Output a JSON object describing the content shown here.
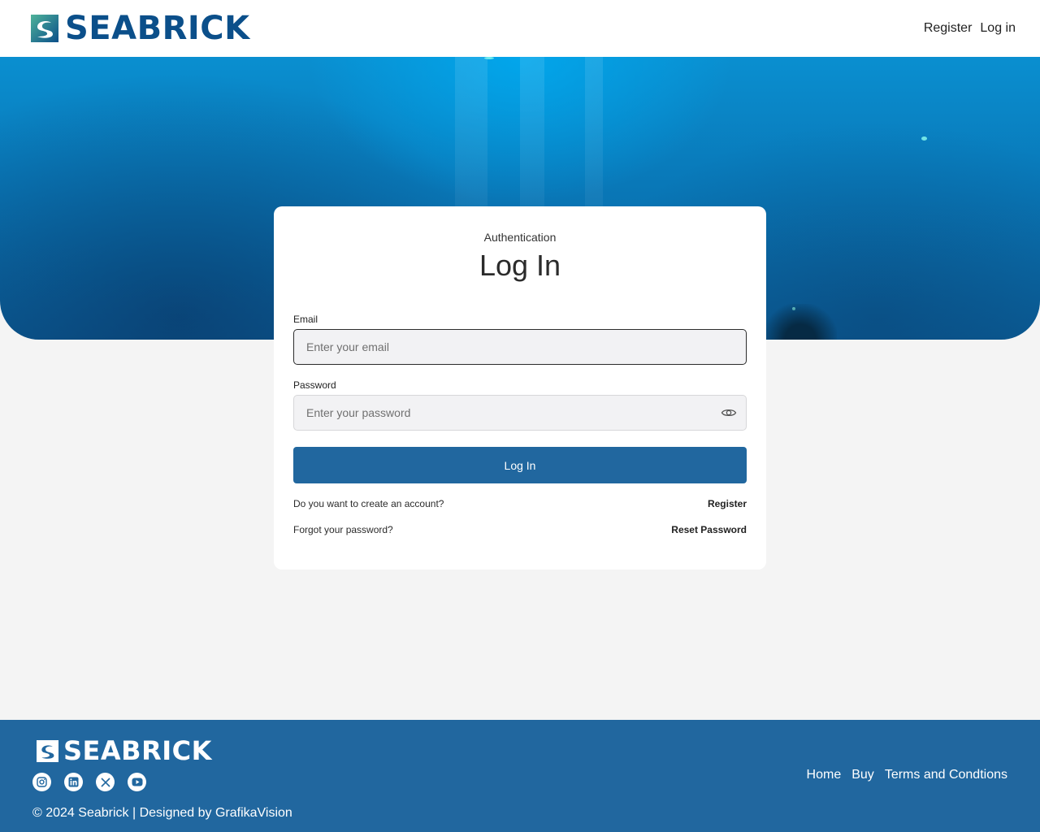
{
  "brand": {
    "name": "SEABRICK",
    "primary_color": "#21679f",
    "logo_color": "#0b4f8a"
  },
  "header": {
    "nav": [
      {
        "label": "Register"
      },
      {
        "label": "Log in"
      }
    ]
  },
  "login_card": {
    "eyebrow": "Authentication",
    "title": "Log In",
    "email": {
      "label": "Email",
      "placeholder": "Enter your email",
      "value": ""
    },
    "password": {
      "label": "Password",
      "placeholder": "Enter your password",
      "value": "",
      "toggle_icon": "eye-icon"
    },
    "submit_label": "Log In",
    "create_account": {
      "prompt": "Do you want to create an account?",
      "link": "Register"
    },
    "forgot_password": {
      "prompt": "Forgot your password?",
      "link": "Reset Password"
    }
  },
  "footer": {
    "socials": [
      {
        "icon": "instagram-icon"
      },
      {
        "icon": "linkedin-icon"
      },
      {
        "icon": "x-icon"
      },
      {
        "icon": "youtube-icon"
      }
    ],
    "copyright": "© 2024 Seabrick | Designed by GrafikaVision",
    "nav": [
      {
        "label": "Home"
      },
      {
        "label": "Buy"
      },
      {
        "label": "Terms and Condtions"
      }
    ]
  }
}
